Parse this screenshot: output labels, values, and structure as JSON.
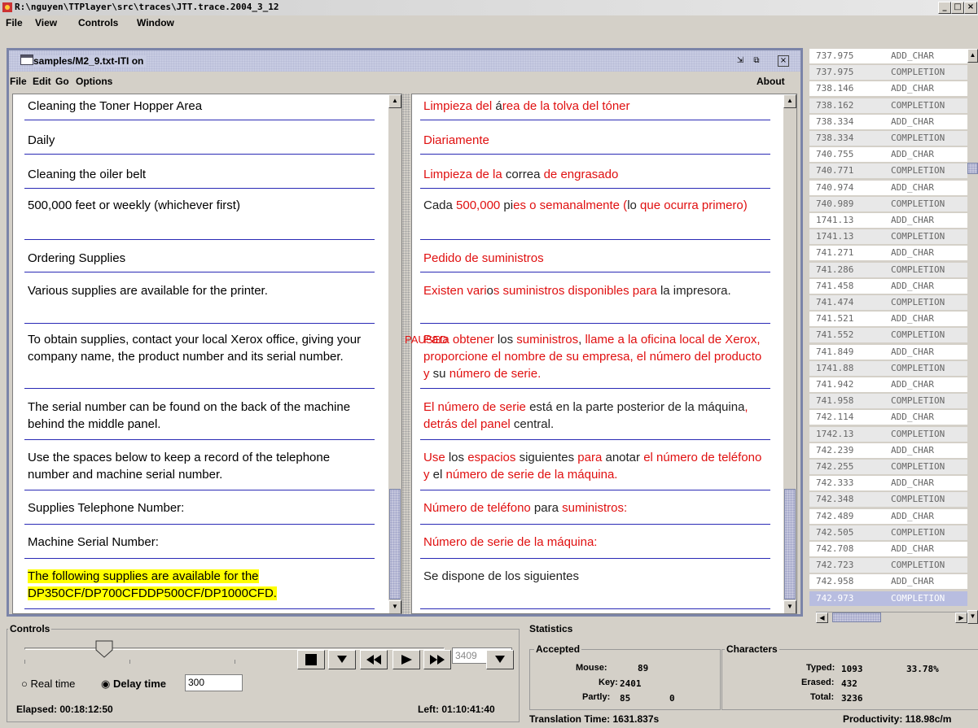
{
  "window": {
    "title": "R:\\nguyen\\TTPlayer\\src\\traces\\JTT.trace.2004_3_12",
    "buttons": [
      "_",
      "□",
      "×"
    ]
  },
  "menubar": [
    "File",
    "View",
    "Controls",
    "Window"
  ],
  "doc_window": {
    "title": "samples/M2_9.txt-ITI on",
    "menu": [
      "File",
      "Edit",
      "Go",
      "Options"
    ],
    "about": "About"
  },
  "overlay_text": "PAUSED",
  "source_segments": [
    "Cleaning the Toner Hopper Area",
    "Daily",
    "Cleaning the oiler belt",
    "500,000 feet or weekly (whichever first)",
    "Ordering Supplies",
    "Various supplies are available for the printer.",
    "To obtain supplies, contact your local Xerox office, giving your company name, the product number and its serial number.",
    "The serial number can be found on the back of the machine behind the middle panel.",
    "Use the spaces below to keep a record of the telephone number and machine serial number.",
    "Supplies Telephone Number:",
    "Machine Serial Number:",
    "The following supplies are available for the DP350CF/DP700CFDDP500CF/DP1000CFD."
  ],
  "target_segments": [
    [
      {
        "t": "Limpieza del ",
        "c": "r"
      },
      {
        "t": "á",
        "c": "k"
      },
      {
        "t": "rea de la tolva del tóner",
        "c": "r"
      }
    ],
    [
      {
        "t": "Diariamente",
        "c": "r"
      }
    ],
    [
      {
        "t": "Limpieza de la ",
        "c": "r"
      },
      {
        "t": "correa ",
        "c": "k"
      },
      {
        "t": "de engrasado",
        "c": "r"
      }
    ],
    [
      {
        "t": "Cada ",
        "c": "k"
      },
      {
        "t": "500,000 ",
        "c": "r"
      },
      {
        "t": "pi",
        "c": "k"
      },
      {
        "t": "es o semanalmente (",
        "c": "r"
      },
      {
        "t": "lo ",
        "c": "k"
      },
      {
        "t": "que ocurra primero)",
        "c": "r"
      }
    ],
    [
      {
        "t": "Pedido de suministros",
        "c": "r"
      }
    ],
    [
      {
        "t": "Existen vari",
        "c": "r"
      },
      {
        "t": "o",
        "c": "k"
      },
      {
        "t": "s suministros disponibles para ",
        "c": "r"
      },
      {
        "t": "la impresora.",
        "c": "k"
      }
    ],
    [
      {
        "t": "Para obtener ",
        "c": "r"
      },
      {
        "t": "los ",
        "c": "k"
      },
      {
        "t": "suministros",
        "c": "r"
      },
      {
        "t": ", ",
        "c": "k"
      },
      {
        "t": "llame a la oficina local de Xerox, proporcione el nombre de su empresa, el número del producto y ",
        "c": "r"
      },
      {
        "t": "su ",
        "c": "k"
      },
      {
        "t": "número de serie.",
        "c": "r"
      }
    ],
    [
      {
        "t": "El número de serie ",
        "c": "r"
      },
      {
        "t": "está en la parte posterior de la máquina",
        "c": "k"
      },
      {
        "t": ", detrás del panel ",
        "c": "r"
      },
      {
        "t": "central.",
        "c": "k"
      }
    ],
    [
      {
        "t": "Use ",
        "c": "r"
      },
      {
        "t": "los ",
        "c": "k"
      },
      {
        "t": "espacios ",
        "c": "r"
      },
      {
        "t": "siguientes ",
        "c": "k"
      },
      {
        "t": "para ",
        "c": "r"
      },
      {
        "t": "anotar ",
        "c": "k"
      },
      {
        "t": "el número de teléfono y ",
        "c": "r"
      },
      {
        "t": "el ",
        "c": "k"
      },
      {
        "t": "número de serie de la máquina.",
        "c": "r"
      }
    ],
    [
      {
        "t": "Número de teléfono ",
        "c": "r"
      },
      {
        "t": "para ",
        "c": "k"
      },
      {
        "t": "suministros:",
        "c": "r"
      }
    ],
    [
      {
        "t": "Número de serie de la máquina:",
        "c": "r"
      }
    ],
    [
      {
        "t": "Se dispone de los siguientes",
        "c": "k"
      }
    ]
  ],
  "log": [
    [
      "737.975",
      "ADD_CHAR"
    ],
    [
      "737.975",
      "COMPLETION"
    ],
    [
      "738.146",
      "ADD_CHAR"
    ],
    [
      "738.162",
      "COMPLETION"
    ],
    [
      "738.334",
      "ADD_CHAR"
    ],
    [
      "738.334",
      "COMPLETION"
    ],
    [
      "740.755",
      "ADD_CHAR"
    ],
    [
      "740.771",
      "COMPLETION"
    ],
    [
      "740.974",
      "ADD_CHAR"
    ],
    [
      "740.989",
      "COMPLETION"
    ],
    [
      "1741.13",
      "ADD_CHAR"
    ],
    [
      "1741.13",
      "COMPLETION"
    ],
    [
      "741.271",
      "ADD_CHAR"
    ],
    [
      "741.286",
      "COMPLETION"
    ],
    [
      "741.458",
      "ADD_CHAR"
    ],
    [
      "741.474",
      "COMPLETION"
    ],
    [
      "741.521",
      "ADD_CHAR"
    ],
    [
      "741.552",
      "COMPLETION"
    ],
    [
      "741.849",
      "ADD_CHAR"
    ],
    [
      "1741.88",
      "COMPLETION"
    ],
    [
      "741.942",
      "ADD_CHAR"
    ],
    [
      "741.958",
      "COMPLETION"
    ],
    [
      "742.114",
      "ADD_CHAR"
    ],
    [
      "1742.13",
      "COMPLETION"
    ],
    [
      "742.239",
      "ADD_CHAR"
    ],
    [
      "742.255",
      "COMPLETION"
    ],
    [
      "742.333",
      "ADD_CHAR"
    ],
    [
      "742.348",
      "COMPLETION"
    ],
    [
      "742.489",
      "ADD_CHAR"
    ],
    [
      "742.505",
      "COMPLETION"
    ],
    [
      "742.708",
      "ADD_CHAR"
    ],
    [
      "742.723",
      "COMPLETION"
    ],
    [
      "742.958",
      "ADD_CHAR"
    ],
    [
      "742.973",
      "COMPLETION"
    ]
  ],
  "controls": {
    "label": "Controls",
    "slider_value": "3409",
    "slider_fraction": 0.19,
    "realtime_label": "Real time",
    "delaytime_label": "Delay time",
    "delay_value": "300",
    "mode": "delay",
    "elapsed": "Elapsed: 00:18:12:50",
    "left": "Left: 01:10:41:40"
  },
  "statistics": {
    "label": "Statistics",
    "accepted_label": "Accepted",
    "mouse_label": "Mouse:",
    "mouse_value": "89",
    "key_label": "Key:",
    "key_value": "2401",
    "partly_label": "Partly:",
    "partly_value": "85",
    "partly_value2": "0",
    "characters_label": "Characters",
    "typed_label": "Typed:",
    "typed_value": "1093",
    "typed_pct": "33.78%",
    "erased_label": "Erased:",
    "erased_value": "432",
    "total_label": "Total:",
    "total_value": "3236",
    "translation_time": "Translation Time: 1631.837s",
    "productivity": "Productivity: 118.98c/m"
  }
}
